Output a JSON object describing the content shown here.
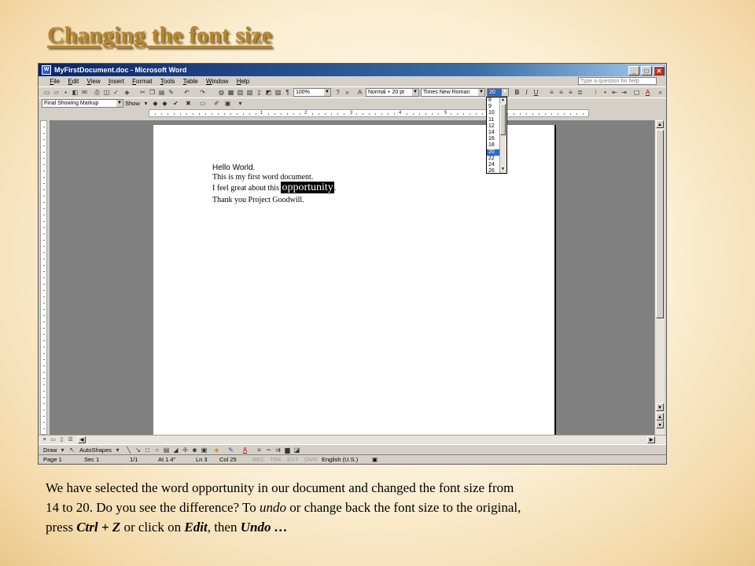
{
  "slide": {
    "title": "Changing the font size",
    "caption": {
      "line1": "We have selected the word opportunity in our document and changed the font size from",
      "line2a": "14 to 20. Do you see the difference?  To ",
      "line2_undo": "undo",
      "line2b": " or change back the font size to the original,",
      "line3a": "press ",
      "line3_shortcut": "Ctrl + Z",
      "line3b": "  or click on ",
      "line3_edit": "Edit",
      "line3c": ", then ",
      "line3_undo": "Undo …"
    }
  },
  "window": {
    "title": "MyFirstDocument.doc - Microsoft Word",
    "controls": {
      "minimize": "_",
      "maximize": "□",
      "close": "✕"
    }
  },
  "menu": {
    "items": [
      "File",
      "Edit",
      "View",
      "Insert",
      "Format",
      "Tools",
      "Table",
      "Window",
      "Help"
    ],
    "help_placeholder": "Type a question for help"
  },
  "formatting": {
    "zoom": "100%",
    "style": "Normal + 20 pt",
    "font": "Times New Roman",
    "size": "20"
  },
  "reviewing": {
    "markup_view": "Final Showing Markup",
    "show_label": "Show"
  },
  "font_size_list": {
    "options": [
      "8",
      "9",
      "10",
      "11",
      "12",
      "14",
      "16",
      "18",
      "20",
      "22",
      "24",
      "26"
    ],
    "selected": "20"
  },
  "ruler": {
    "numbers": [
      "1",
      "2",
      "3",
      "4",
      "5"
    ]
  },
  "document": {
    "line1": "Hello World.",
    "line2": "This is my first word document.",
    "line3_before": "I feel great about this ",
    "line3_selected": "opportunity",
    "line3_after": ".",
    "line4": "Thank you Project Goodwill."
  },
  "drawing": {
    "draw_label": "Draw",
    "autoshapes_label": "AutoShapes"
  },
  "status": {
    "page": "Page 1",
    "sec": "Sec 1",
    "pages": "1/1",
    "at": "At 1.4\"",
    "ln": "Ln 3",
    "col": "Col 25",
    "rec": "REC",
    "trk": "TRK",
    "ext": "EXT",
    "ovr": "OVR",
    "language": "English (U.S.)"
  }
}
